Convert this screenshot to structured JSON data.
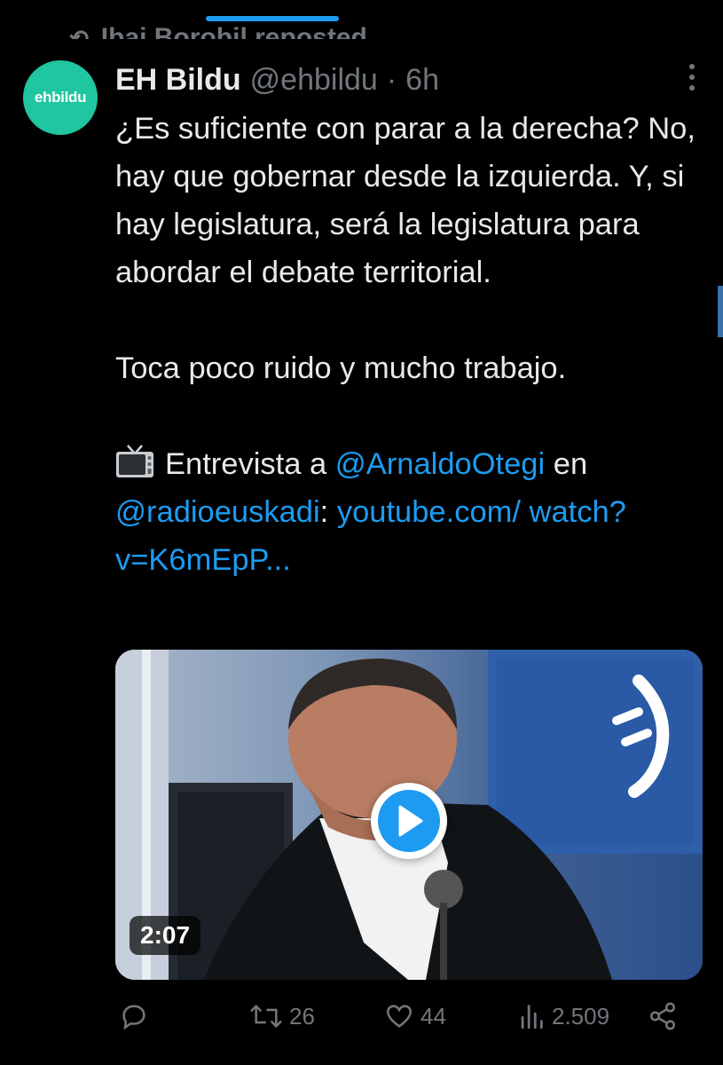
{
  "repost": {
    "text": "Ibai Borobil reposted"
  },
  "tweet": {
    "author_name": "EH Bildu",
    "handle": "@ehbildu",
    "separator": "·",
    "time": "6h",
    "avatar_text": "ehbildu",
    "paragraph1": "¿Es suficiente con parar a la derecha? No, hay que gobernar desde la izquierda. Y, si hay legislatura, será la legislatura para abordar el debate territorial.",
    "paragraph2": "Toca poco ruido y mucho trabajo.",
    "interview_prefix": "Entrevista a",
    "mention1": "@ArnaldoOtegi",
    "connector": "en",
    "mention2": "@radioeuskadi",
    "colon": ":",
    "link": "youtube.com/ watch?v=K6mEpP..."
  },
  "media": {
    "duration": "2:07",
    "type": "video"
  },
  "actions": {
    "replies": "",
    "reposts": "26",
    "likes": "44",
    "views": "2.509"
  },
  "colors": {
    "background": "#000000",
    "text": "#e7e9ea",
    "muted": "#71767b",
    "accent": "#1d9bf0",
    "avatar": "#1fc6a0"
  },
  "icons": {
    "reply": "reply-icon",
    "repost": "repost-icon",
    "like": "heart-icon",
    "views": "views-icon",
    "share": "share-icon",
    "more": "more-icon",
    "tv": "television-icon",
    "play": "play-icon"
  }
}
